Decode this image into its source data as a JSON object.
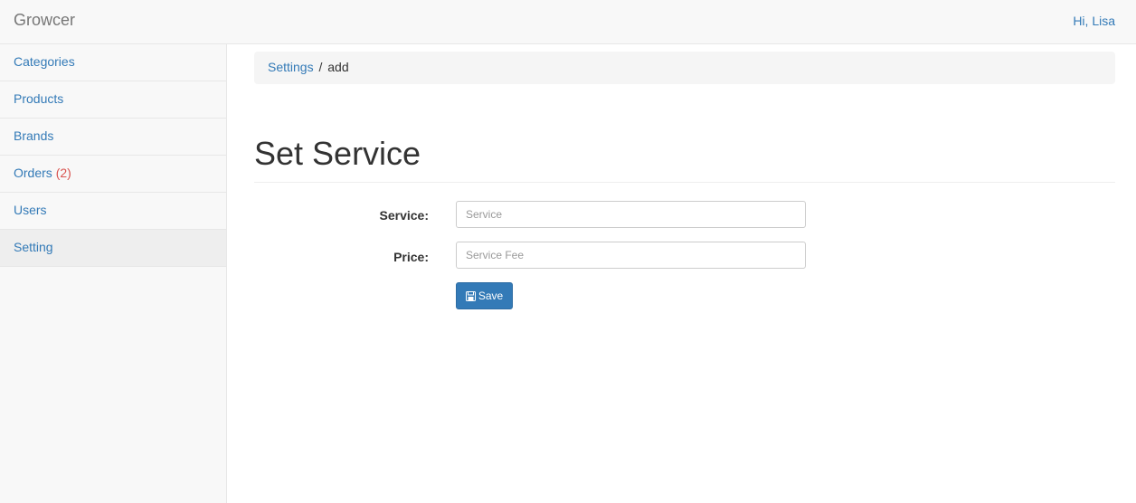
{
  "navbar": {
    "brand": "Growcer",
    "greeting": "Hi, Lisa"
  },
  "sidebar": {
    "items": [
      {
        "label": "Categories"
      },
      {
        "label": "Products"
      },
      {
        "label": "Brands"
      },
      {
        "label": "Orders",
        "count": "(2)"
      },
      {
        "label": "Users"
      },
      {
        "label": "Setting",
        "active": true
      }
    ]
  },
  "breadcrumb": {
    "link": "Settings",
    "separator": "/",
    "current": "add"
  },
  "page": {
    "title": "Set Service"
  },
  "form": {
    "service_label": "Service:",
    "service_placeholder": "Service",
    "service_value": "",
    "price_label": "Price:",
    "price_placeholder": "Service Fee",
    "price_value": "",
    "save_label": "Save",
    "save_icon": "floppy-disk-icon"
  },
  "colors": {
    "link": "#337ab7",
    "primary_button": "#337ab7",
    "badge": "#d9534f"
  }
}
